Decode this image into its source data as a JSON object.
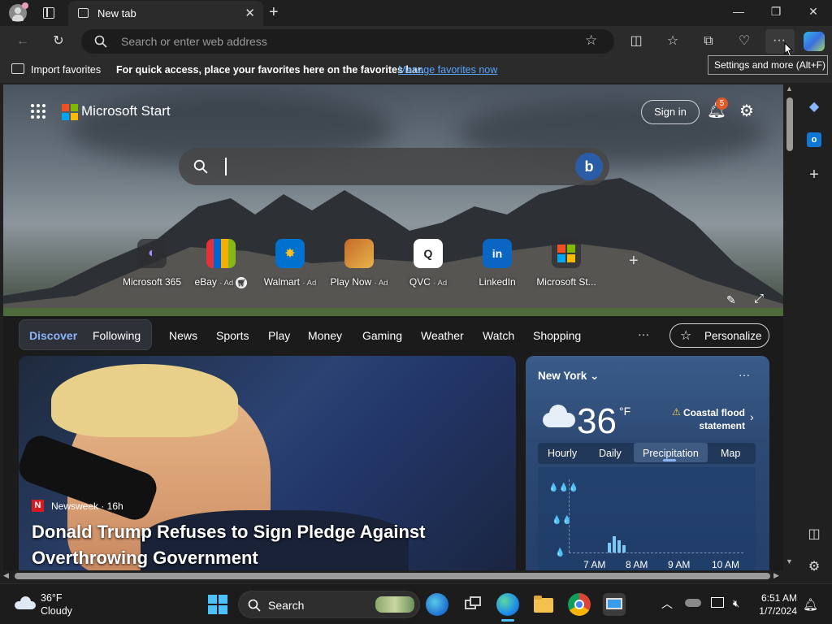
{
  "browser": {
    "tab_title": "New tab",
    "address_placeholder": "Search or enter web address",
    "tooltip": "Settings and more (Alt+F)"
  },
  "favorites_bar": {
    "import_label": "Import favorites",
    "message": "For quick access, place your favorites here on the favorites bar.",
    "manage_link": "Manage favorites now"
  },
  "header": {
    "brand": "Microsoft Start",
    "sign_in": "Sign in",
    "notification_count": "5"
  },
  "quick_links": [
    {
      "label": "Microsoft 365",
      "ad": ""
    },
    {
      "label": "eBay",
      "ad": "· Ad"
    },
    {
      "label": "Walmart",
      "ad": "· Ad"
    },
    {
      "label": "Play Now",
      "ad": "· Ad"
    },
    {
      "label": "QVC",
      "ad": "· Ad"
    },
    {
      "label": "LinkedIn",
      "ad": ""
    },
    {
      "label": "Microsoft St...",
      "ad": ""
    }
  ],
  "nav": {
    "discover": "Discover",
    "following": "Following",
    "items": [
      "News",
      "Sports",
      "Play",
      "Money",
      "Gaming",
      "Weather",
      "Watch",
      "Shopping"
    ],
    "more": "···",
    "personalize": "Personalize"
  },
  "news": {
    "source": "Newsweek · 16h",
    "headline": "Donald Trump Refuses to Sign Pledge Against Overthrowing Government"
  },
  "weather": {
    "location": "New York",
    "temperature": "36",
    "unit": "°F",
    "alert": "Coastal flood statement",
    "tabs": [
      "Hourly",
      "Daily",
      "Precipitation",
      "Map"
    ],
    "active_tab": "Precipitation",
    "times": [
      "7 AM",
      "8 AM",
      "9 AM",
      "10 AM"
    ]
  },
  "taskbar": {
    "weather_temp": "36°F",
    "weather_desc": "Cloudy",
    "search_label": "Search",
    "time": "6:51 AM",
    "date": "1/7/2024"
  }
}
